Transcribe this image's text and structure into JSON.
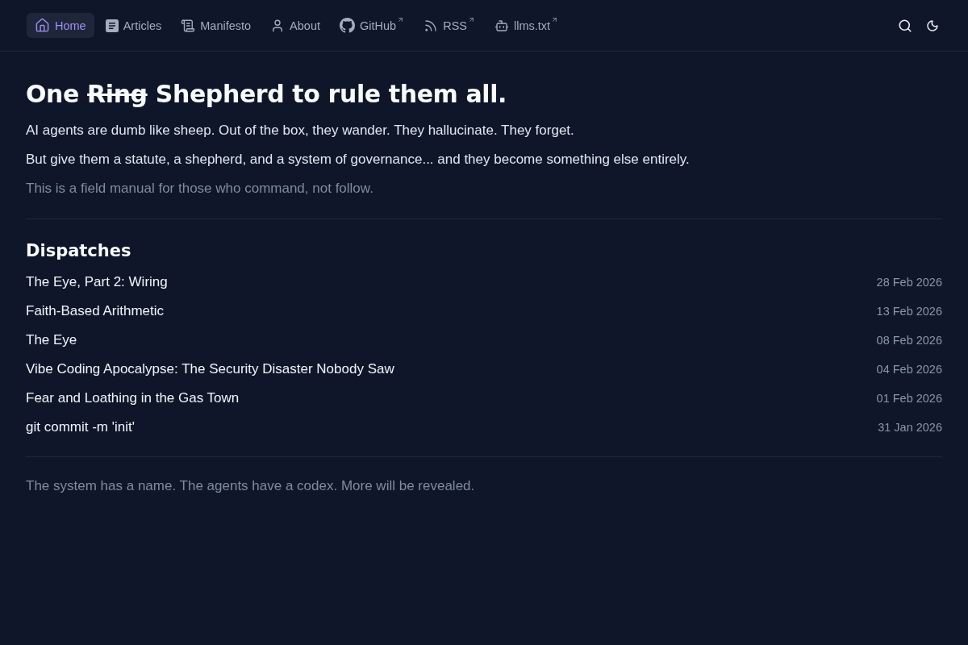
{
  "nav": {
    "items": [
      {
        "label": "Home",
        "selected": true,
        "external": false
      },
      {
        "label": "Articles",
        "selected": false,
        "external": false
      },
      {
        "label": "Manifesto",
        "selected": false,
        "external": false
      },
      {
        "label": "About",
        "selected": false,
        "external": false
      },
      {
        "label": "GitHub",
        "selected": false,
        "external": true
      },
      {
        "label": "RSS",
        "selected": false,
        "external": true
      },
      {
        "label": "llms.txt",
        "selected": false,
        "external": true
      }
    ]
  },
  "hero": {
    "title": [
      {
        "text": "One",
        "struck": false
      },
      {
        "text": "Ring",
        "struck": true
      },
      {
        "text": "Shepherd to rule them all.",
        "struck": false
      }
    ],
    "paragraphs": [
      {
        "text": "AI agents are dumb like sheep. Out of the box, they wander. They hallucinate. They forget.",
        "muted": false
      },
      {
        "text": "But give them a statute, a shepherd, and a system of governance... and they become something else entirely.",
        "muted": false
      },
      {
        "text": "This is a field manual for those who command, not follow.",
        "muted": true
      }
    ]
  },
  "dispatches": {
    "heading": "Dispatches",
    "items": [
      {
        "title": "The Eye, Part 2: Wiring",
        "date": "28 Feb 2026"
      },
      {
        "title": "Faith-Based Arithmetic",
        "date": "13 Feb 2026"
      },
      {
        "title": "The Eye",
        "date": "08 Feb 2026"
      },
      {
        "title": "Vibe Coding Apocalypse: The Security Disaster Nobody Saw",
        "date": "04 Feb 2026"
      },
      {
        "title": "Fear and Loathing in the Gas Town",
        "date": "01 Feb 2026"
      },
      {
        "title": "git commit -m 'init'",
        "date": "31 Jan 2026"
      }
    ]
  },
  "footer": {
    "text": "The system has a name. The agents have a codex. More will be revealed."
  }
}
